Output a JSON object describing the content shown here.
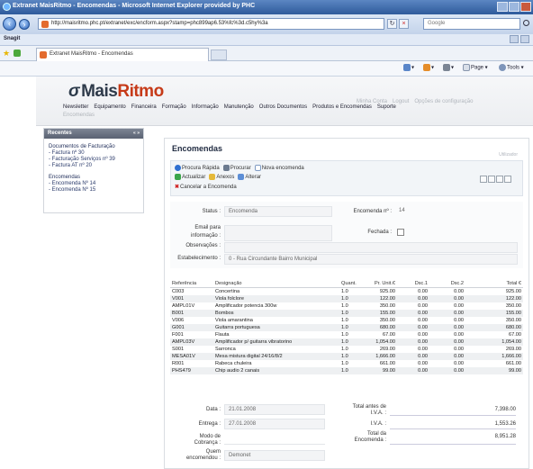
{
  "browser": {
    "title": "Extranet MaisRitmo - Encomendas - Microsoft Internet Explorer provided by PHC",
    "url": "http://maisritmo.phc.pt/extranet/exc/encform.aspx?stamp=phc899ap6.53%fc%3d.c5hy%3a",
    "search_placeholder": "Google",
    "links_label": "Snagit",
    "tab_label": "Extranet MaisRitmo - Encomendas",
    "cmd_page": "Page",
    "cmd_tools": "Tools"
  },
  "site": {
    "logo_mais": "Mais",
    "logo_ritmo": "Ritmo",
    "nav": [
      "Newsletter",
      "Equipamento",
      "Financeira",
      "Formação",
      "Informação",
      "Manutenção",
      "Outros Documentos",
      "Produtos e Encomendas",
      "Suporte"
    ],
    "subnav": "Encomendas",
    "user_links": [
      "Minha Conta",
      "Logout",
      "Opções de configuração"
    ]
  },
  "sidebar": {
    "title": "Recentes",
    "controls": "« »",
    "groups": [
      {
        "title": "Documentos de Facturação",
        "items": [
          "- Factura nº 30",
          "- Facturação Serviços nº 39",
          "- Factura AT nº 20"
        ]
      },
      {
        "title": "Encomendas",
        "items": [
          "- Encomenda Nº 14",
          "- Encomenda Nº 15"
        ]
      }
    ]
  },
  "main": {
    "title": "Encomendas",
    "user": "Utilizador",
    "toolbar": {
      "procura_rapida": "Procura Rápida",
      "procurar": "Procurar",
      "nova_encomenda": "Nova encomenda",
      "actualizar": "Actualizar",
      "anexos": "Anexos",
      "alterar": "Alterar",
      "cancelar": "Cancelar a Encomenda"
    },
    "form": {
      "status_label": "Status :",
      "status_value": "Encomenda",
      "encomenda_label": "Encomenda nº :",
      "encomenda_value": "14",
      "email_label": "Email para",
      "informacao_label": "informação :",
      "fechada_label": "Fechada :",
      "observacoes_label": "Observações :",
      "estabelecimento_label": "Estabelecimento :",
      "estabelecimento_value": "0 - Rua Circundante Bairro Municipal"
    },
    "table": {
      "headers": [
        "Referência",
        "Designação",
        "Quant.",
        "Pr. Unit.€",
        "Dsc.1",
        "Dsc.2",
        "Total €"
      ],
      "rows": [
        [
          "C003",
          "Concertina",
          "1.0",
          "925.00",
          "0.00",
          "0.00",
          "925.00"
        ],
        [
          "V001",
          "Viola folclore",
          "1.0",
          "122.00",
          "0.00",
          "0.00",
          "122.00"
        ],
        [
          "AMPL01V",
          "Amplificador potencia 300w",
          "1.0",
          "350.00",
          "0.00",
          "0.00",
          "350.00"
        ],
        [
          "B001",
          "Bombos",
          "1.0",
          "155.00",
          "0.00",
          "0.00",
          "155.00"
        ],
        [
          "V006",
          "Viola amarantina",
          "1.0",
          "350.00",
          "0.00",
          "0.00",
          "350.00"
        ],
        [
          "G001",
          "Guitarra portuguesa",
          "1.0",
          "680.00",
          "0.00",
          "0.00",
          "680.00"
        ],
        [
          "F001",
          "Flauta",
          "1.0",
          "67.00",
          "0.00",
          "0.00",
          "67.00"
        ],
        [
          "AMPL03V",
          "Amplificador p/ guitarra vibratorino",
          "1.0",
          "1,054.00",
          "0.00",
          "0.00",
          "1,054.00"
        ],
        [
          "S001",
          "Sarronca",
          "1.0",
          "269.00",
          "0.00",
          "0.00",
          "269.00"
        ],
        [
          "MESA01V",
          "Mesa mistura digital 24/16/8/2",
          "1.0",
          "1,666.00",
          "0.00",
          "0.00",
          "1,666.00"
        ],
        [
          "R001",
          "Rabeca chuleira",
          "1.0",
          "661.00",
          "0.00",
          "0.00",
          "661.00"
        ],
        [
          "PHS479",
          "Chip audio 2 canais",
          "1.0",
          "99.00",
          "0.00",
          "0.00",
          "99.00"
        ]
      ]
    },
    "bottom": {
      "data_label": "Data :",
      "data_value": "21.01.2008",
      "entrega_label": "Entrega :",
      "entrega_value": "27.01.2008",
      "modo_label_1": "Modo de",
      "modo_label_2": "Cobrança :",
      "quem_label_1": "Quem",
      "quem_label_2": "encomendou :",
      "quem_value": "Demonet",
      "total_antes_label": "Total antes de",
      "iva_label": "I.V.A. :",
      "iva_label_2": "I.V.A. :",
      "total_enc_label_1": "Total da",
      "total_enc_label_2": "Encomenda :",
      "total_antes_value": "7,398.00",
      "iva_value": "1,553.26",
      "total_enc_value": "8,951.28"
    }
  }
}
